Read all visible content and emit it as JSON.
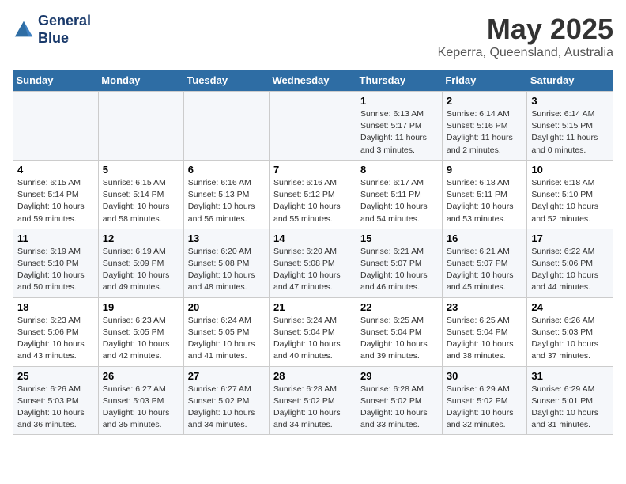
{
  "header": {
    "logo_line1": "General",
    "logo_line2": "Blue",
    "title": "May 2025",
    "subtitle": "Keperra, Queensland, Australia"
  },
  "weekdays": [
    "Sunday",
    "Monday",
    "Tuesday",
    "Wednesday",
    "Thursday",
    "Friday",
    "Saturday"
  ],
  "weeks": [
    [
      {
        "day": "",
        "sunrise": "",
        "sunset": "",
        "daylight": ""
      },
      {
        "day": "",
        "sunrise": "",
        "sunset": "",
        "daylight": ""
      },
      {
        "day": "",
        "sunrise": "",
        "sunset": "",
        "daylight": ""
      },
      {
        "day": "",
        "sunrise": "",
        "sunset": "",
        "daylight": ""
      },
      {
        "day": "1",
        "sunrise": "Sunrise: 6:13 AM",
        "sunset": "Sunset: 5:17 PM",
        "daylight": "Daylight: 11 hours and 3 minutes."
      },
      {
        "day": "2",
        "sunrise": "Sunrise: 6:14 AM",
        "sunset": "Sunset: 5:16 PM",
        "daylight": "Daylight: 11 hours and 2 minutes."
      },
      {
        "day": "3",
        "sunrise": "Sunrise: 6:14 AM",
        "sunset": "Sunset: 5:15 PM",
        "daylight": "Daylight: 11 hours and 0 minutes."
      }
    ],
    [
      {
        "day": "4",
        "sunrise": "Sunrise: 6:15 AM",
        "sunset": "Sunset: 5:14 PM",
        "daylight": "Daylight: 10 hours and 59 minutes."
      },
      {
        "day": "5",
        "sunrise": "Sunrise: 6:15 AM",
        "sunset": "Sunset: 5:14 PM",
        "daylight": "Daylight: 10 hours and 58 minutes."
      },
      {
        "day": "6",
        "sunrise": "Sunrise: 6:16 AM",
        "sunset": "Sunset: 5:13 PM",
        "daylight": "Daylight: 10 hours and 56 minutes."
      },
      {
        "day": "7",
        "sunrise": "Sunrise: 6:16 AM",
        "sunset": "Sunset: 5:12 PM",
        "daylight": "Daylight: 10 hours and 55 minutes."
      },
      {
        "day": "8",
        "sunrise": "Sunrise: 6:17 AM",
        "sunset": "Sunset: 5:11 PM",
        "daylight": "Daylight: 10 hours and 54 minutes."
      },
      {
        "day": "9",
        "sunrise": "Sunrise: 6:18 AM",
        "sunset": "Sunset: 5:11 PM",
        "daylight": "Daylight: 10 hours and 53 minutes."
      },
      {
        "day": "10",
        "sunrise": "Sunrise: 6:18 AM",
        "sunset": "Sunset: 5:10 PM",
        "daylight": "Daylight: 10 hours and 52 minutes."
      }
    ],
    [
      {
        "day": "11",
        "sunrise": "Sunrise: 6:19 AM",
        "sunset": "Sunset: 5:10 PM",
        "daylight": "Daylight: 10 hours and 50 minutes."
      },
      {
        "day": "12",
        "sunrise": "Sunrise: 6:19 AM",
        "sunset": "Sunset: 5:09 PM",
        "daylight": "Daylight: 10 hours and 49 minutes."
      },
      {
        "day": "13",
        "sunrise": "Sunrise: 6:20 AM",
        "sunset": "Sunset: 5:08 PM",
        "daylight": "Daylight: 10 hours and 48 minutes."
      },
      {
        "day": "14",
        "sunrise": "Sunrise: 6:20 AM",
        "sunset": "Sunset: 5:08 PM",
        "daylight": "Daylight: 10 hours and 47 minutes."
      },
      {
        "day": "15",
        "sunrise": "Sunrise: 6:21 AM",
        "sunset": "Sunset: 5:07 PM",
        "daylight": "Daylight: 10 hours and 46 minutes."
      },
      {
        "day": "16",
        "sunrise": "Sunrise: 6:21 AM",
        "sunset": "Sunset: 5:07 PM",
        "daylight": "Daylight: 10 hours and 45 minutes."
      },
      {
        "day": "17",
        "sunrise": "Sunrise: 6:22 AM",
        "sunset": "Sunset: 5:06 PM",
        "daylight": "Daylight: 10 hours and 44 minutes."
      }
    ],
    [
      {
        "day": "18",
        "sunrise": "Sunrise: 6:23 AM",
        "sunset": "Sunset: 5:06 PM",
        "daylight": "Daylight: 10 hours and 43 minutes."
      },
      {
        "day": "19",
        "sunrise": "Sunrise: 6:23 AM",
        "sunset": "Sunset: 5:05 PM",
        "daylight": "Daylight: 10 hours and 42 minutes."
      },
      {
        "day": "20",
        "sunrise": "Sunrise: 6:24 AM",
        "sunset": "Sunset: 5:05 PM",
        "daylight": "Daylight: 10 hours and 41 minutes."
      },
      {
        "day": "21",
        "sunrise": "Sunrise: 6:24 AM",
        "sunset": "Sunset: 5:04 PM",
        "daylight": "Daylight: 10 hours and 40 minutes."
      },
      {
        "day": "22",
        "sunrise": "Sunrise: 6:25 AM",
        "sunset": "Sunset: 5:04 PM",
        "daylight": "Daylight: 10 hours and 39 minutes."
      },
      {
        "day": "23",
        "sunrise": "Sunrise: 6:25 AM",
        "sunset": "Sunset: 5:04 PM",
        "daylight": "Daylight: 10 hours and 38 minutes."
      },
      {
        "day": "24",
        "sunrise": "Sunrise: 6:26 AM",
        "sunset": "Sunset: 5:03 PM",
        "daylight": "Daylight: 10 hours and 37 minutes."
      }
    ],
    [
      {
        "day": "25",
        "sunrise": "Sunrise: 6:26 AM",
        "sunset": "Sunset: 5:03 PM",
        "daylight": "Daylight: 10 hours and 36 minutes."
      },
      {
        "day": "26",
        "sunrise": "Sunrise: 6:27 AM",
        "sunset": "Sunset: 5:03 PM",
        "daylight": "Daylight: 10 hours and 35 minutes."
      },
      {
        "day": "27",
        "sunrise": "Sunrise: 6:27 AM",
        "sunset": "Sunset: 5:02 PM",
        "daylight": "Daylight: 10 hours and 34 minutes."
      },
      {
        "day": "28",
        "sunrise": "Sunrise: 6:28 AM",
        "sunset": "Sunset: 5:02 PM",
        "daylight": "Daylight: 10 hours and 34 minutes."
      },
      {
        "day": "29",
        "sunrise": "Sunrise: 6:28 AM",
        "sunset": "Sunset: 5:02 PM",
        "daylight": "Daylight: 10 hours and 33 minutes."
      },
      {
        "day": "30",
        "sunrise": "Sunrise: 6:29 AM",
        "sunset": "Sunset: 5:02 PM",
        "daylight": "Daylight: 10 hours and 32 minutes."
      },
      {
        "day": "31",
        "sunrise": "Sunrise: 6:29 AM",
        "sunset": "Sunset: 5:01 PM",
        "daylight": "Daylight: 10 hours and 31 minutes."
      }
    ]
  ]
}
